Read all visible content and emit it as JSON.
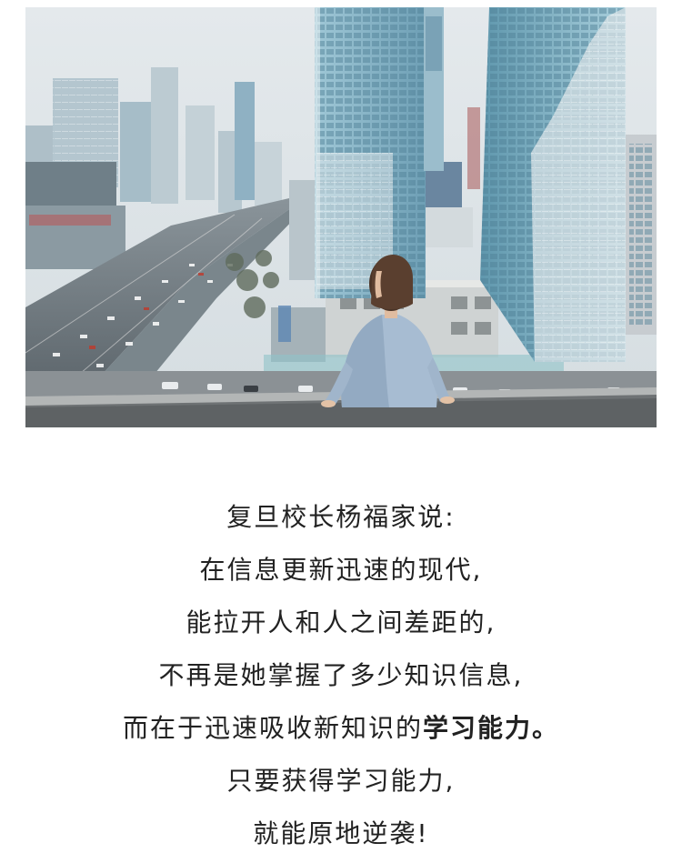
{
  "photo": {
    "subject": "woman-sitting-on-rooftop-overlooking-city"
  },
  "text": {
    "line1": "复旦校长杨福家说:",
    "line2": "在信息更新迅速的现代,",
    "line3": "能拉开人和人之间差距的,",
    "line4": "不再是她掌握了多少知识信息,",
    "line5_normal": "而在于迅速吸收新知识的",
    "line5_bold": "学习能力。",
    "line6": "只要获得学习能力,",
    "line7": "就能原地逆袭!"
  },
  "colors": {
    "text": "#222222",
    "sky": "#dfe6ea",
    "glass": "#7fb0c6"
  }
}
